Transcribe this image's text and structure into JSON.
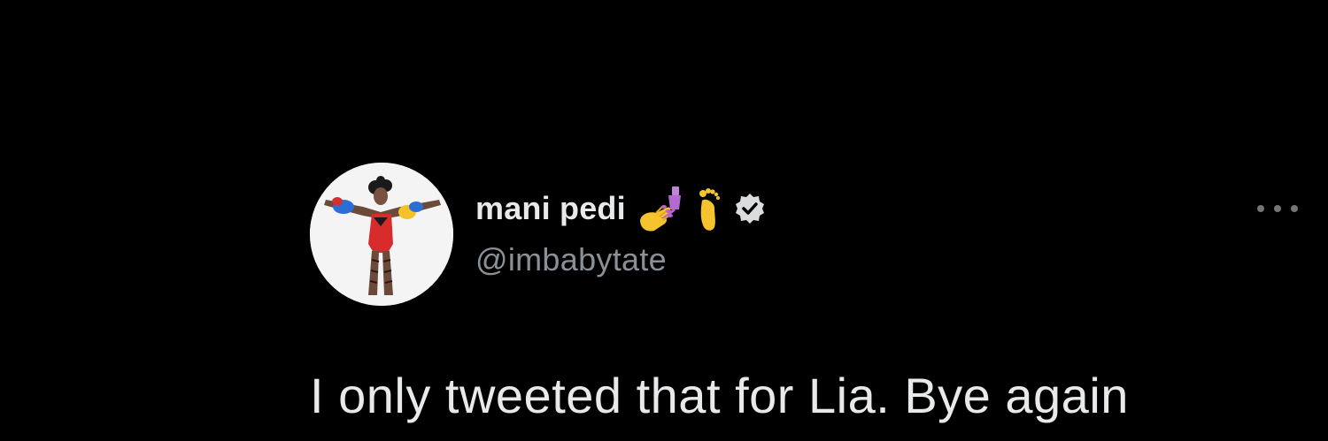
{
  "tweet": {
    "author": {
      "display_name": "mani pedi",
      "handle": "@imbabytate",
      "name_emojis": [
        "nail-polish-icon",
        "foot-icon"
      ],
      "verified": true,
      "verified_icon": "verified-badge-icon"
    },
    "text": "I only tweeted that for Lia. Bye again",
    "more_icon": "more-options-icon"
  },
  "colors": {
    "background": "#000000",
    "primary_text": "#e7e9ea",
    "secondary_text": "#8b9096",
    "icon_gray": "#71767b"
  }
}
